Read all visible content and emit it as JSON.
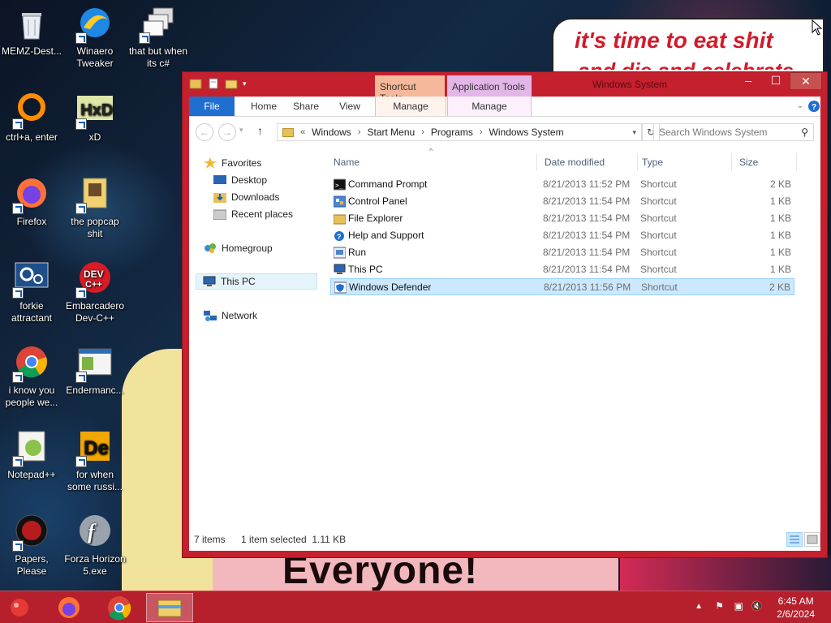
{
  "desktop": {
    "icons": [
      {
        "label": "MEMZ-Dest...",
        "icon": "recycle-bin-icon"
      },
      {
        "label": "Winaero Tweaker",
        "icon": "winaero-icon"
      },
      {
        "label": "that but when its c#",
        "icon": "stacked-windows-icon"
      },
      {
        "label": "ctrl+a, enter",
        "icon": "ring-icon"
      },
      {
        "label": "xD",
        "icon": "hxd-icon"
      },
      {
        "label": "Firefox",
        "icon": "firefox-icon"
      },
      {
        "label": "the popcap shit",
        "icon": "popcap-icon"
      },
      {
        "label": "forkie attractant",
        "icon": "gear-monitor-icon"
      },
      {
        "label": "Embarcadero Dev-C++",
        "icon": "devcpp-icon"
      },
      {
        "label": "i know you people we...",
        "icon": "chrome-icon"
      },
      {
        "label": "Endermanc...",
        "icon": "window-app-icon"
      },
      {
        "label": "Notepad++",
        "icon": "notepadpp-icon"
      },
      {
        "label": "for when some russi...",
        "icon": "de-icon"
      },
      {
        "label": "Papers, Please",
        "icon": "papers-please-icon"
      },
      {
        "label": "Forza Horizon 5.exe",
        "icon": "flash-icon"
      }
    ],
    "wallpaper_text": {
      "speech_line1": "it's time to eat shit",
      "speech_line2": "and die and celebrate",
      "banner": "Everyone!"
    }
  },
  "window": {
    "title": "Windows System",
    "contextual_tabs": {
      "shortcut_tools": "Shortcut Tools",
      "application_tools": "Application Tools"
    },
    "ribbon_tabs": {
      "file": "File",
      "home": "Home",
      "share": "Share",
      "view": "View",
      "manage1": "Manage",
      "manage2": "Manage"
    },
    "address": {
      "overflow": "«",
      "crumbs": [
        "Windows",
        "Start Menu",
        "Programs",
        "Windows System"
      ]
    },
    "search_placeholder": "Search Windows System",
    "nav": {
      "favorites": "Favorites",
      "desktop": "Desktop",
      "downloads": "Downloads",
      "recent": "Recent places",
      "homegroup": "Homegroup",
      "thispc": "This PC",
      "network": "Network"
    },
    "columns": {
      "name": "Name",
      "date": "Date modified",
      "type": "Type",
      "size": "Size"
    },
    "files": [
      {
        "name": "Command Prompt",
        "date": "8/21/2013 11:52 PM",
        "type": "Shortcut",
        "size": "2 KB",
        "icon": "cmd-icon"
      },
      {
        "name": "Control Panel",
        "date": "8/21/2013 11:54 PM",
        "type": "Shortcut",
        "size": "1 KB",
        "icon": "control-panel-icon"
      },
      {
        "name": "File Explorer",
        "date": "8/21/2013 11:54 PM",
        "type": "Shortcut",
        "size": "1 KB",
        "icon": "folder-icon"
      },
      {
        "name": "Help and Support",
        "date": "8/21/2013 11:54 PM",
        "type": "Shortcut",
        "size": "1 KB",
        "icon": "help-icon"
      },
      {
        "name": "Run",
        "date": "8/21/2013 11:54 PM",
        "type": "Shortcut",
        "size": "1 KB",
        "icon": "run-icon"
      },
      {
        "name": "This PC",
        "date": "8/21/2013 11:54 PM",
        "type": "Shortcut",
        "size": "1 KB",
        "icon": "computer-icon"
      },
      {
        "name": "Windows Defender",
        "date": "8/21/2013 11:56 PM",
        "type": "Shortcut",
        "size": "2 KB",
        "icon": "defender-icon"
      }
    ],
    "status": {
      "count": "7 items",
      "selection": "1 item selected  1.11 KB"
    }
  },
  "taskbar": {
    "clock_time": "6:45 AM",
    "clock_date": "2/6/2024"
  },
  "colors": {
    "accent": "#c4202e",
    "file_tab": "#1e6fd0",
    "selection": "#cce8ff"
  }
}
